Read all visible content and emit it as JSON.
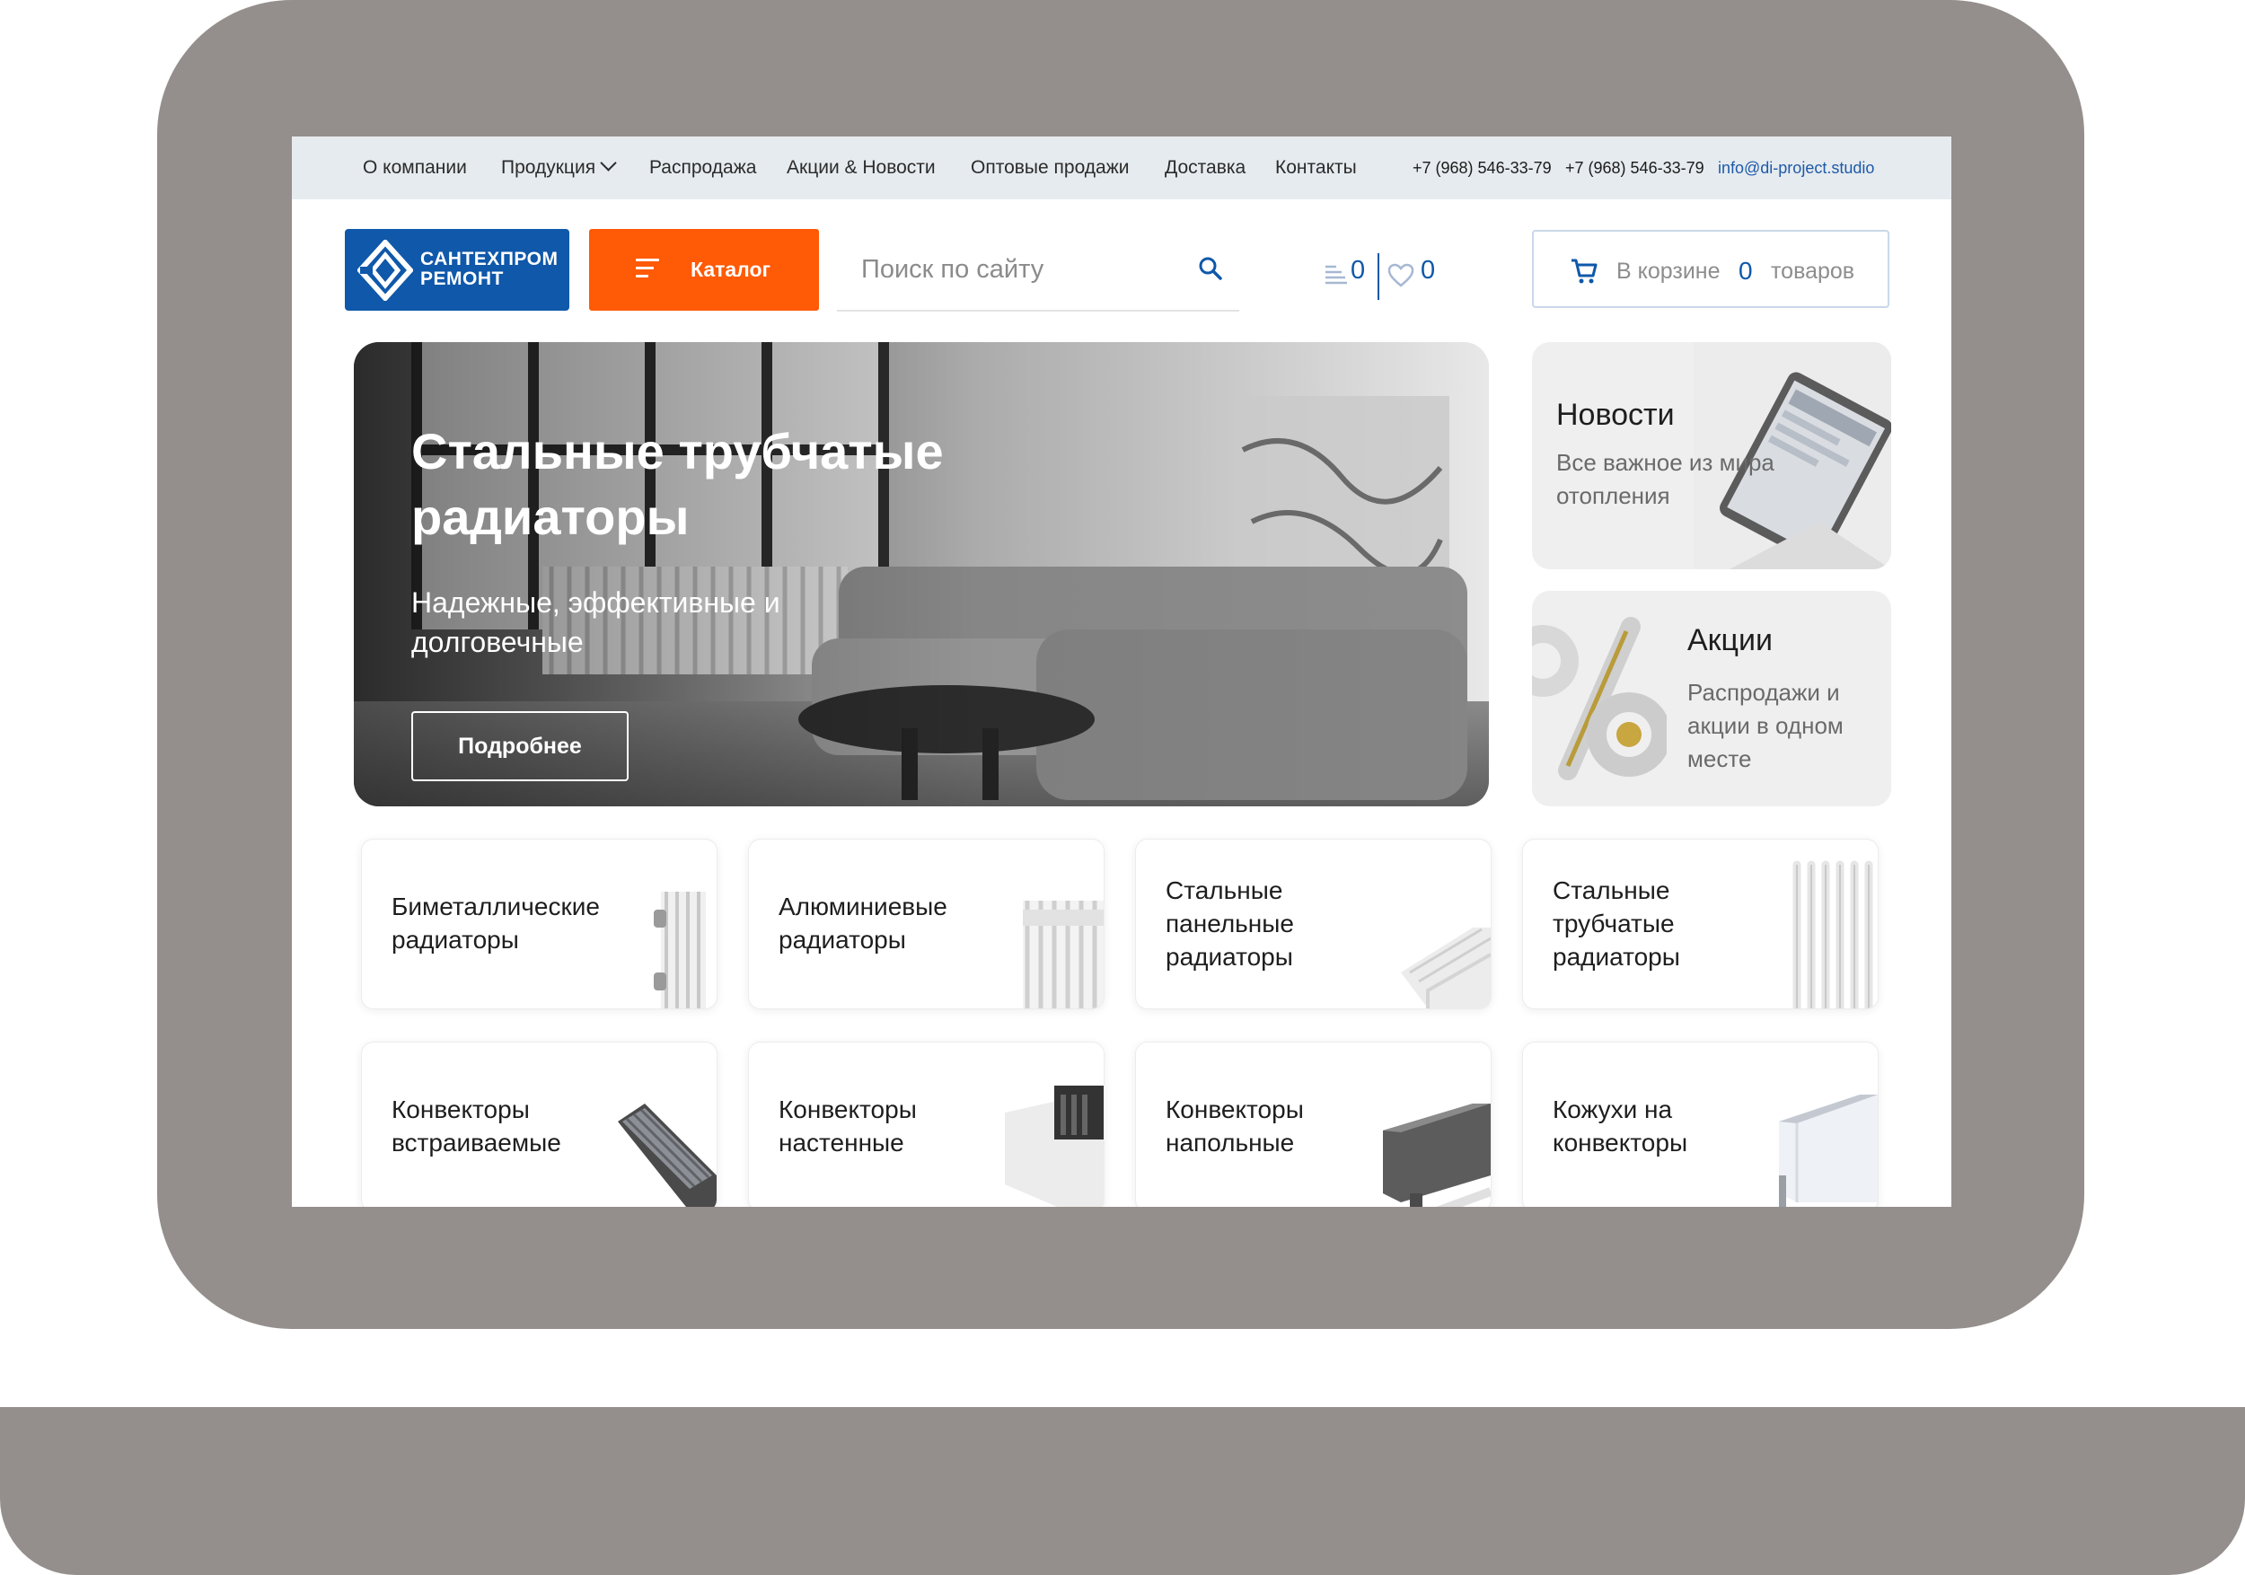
{
  "nav": {
    "items": [
      "О компании",
      "Продукция",
      "Распродажа",
      "Акции & Новости",
      "Оптовые продажи",
      "Доставка",
      "Контакты"
    ],
    "phone_1": "+7 (968) 546-33-79",
    "phone_2": "+7 (968) 546-33-79",
    "email": "info@di-project.studio"
  },
  "header": {
    "logo_line_1": "САНТЕХПРОМ",
    "logo_line_2": "РЕМОНТ",
    "catalog_label": "Каталог",
    "search_placeholder": "Поиск по сайту",
    "compare_count": "0",
    "favorites_count": "0",
    "cart": {
      "prefix": "В корзине",
      "count": "0",
      "suffix": "товаров"
    }
  },
  "hero": {
    "title": "Стальные трубчатые радиаторы",
    "subtitle": "Надежные, эффективные и долговечные",
    "button_label": "Подробнее"
  },
  "side_cards": [
    {
      "title": "Новости",
      "description": "Все важное из мира отопления"
    },
    {
      "title": "Акции",
      "description": "Распродажи и акции в одном месте"
    }
  ],
  "categories": [
    {
      "name": "Биметаллические радиаторы",
      "image": "bimetal-radiator"
    },
    {
      "name": "Алюминиевые радиаторы",
      "image": "aluminium-radiator"
    },
    {
      "name": "Стальные панельные радиаторы",
      "image": "panel-radiator"
    },
    {
      "name": "Стальные трубчатые радиаторы",
      "image": "tubular-radiator"
    },
    {
      "name": "Конвекторы встраиваемые",
      "image": "floor-convector"
    },
    {
      "name": "Конвекторы настенные",
      "image": "wall-convector"
    },
    {
      "name": "Конвекторы напольные",
      "image": "standing-convector"
    },
    {
      "name": "Кожухи на конвекторы",
      "image": "convector-cover"
    }
  ],
  "colors": {
    "brand_blue": "#0f58aa",
    "accent_orange": "#ff5a05",
    "topbar_bg": "#e6ebef",
    "frame_gray": "#948f8c"
  }
}
